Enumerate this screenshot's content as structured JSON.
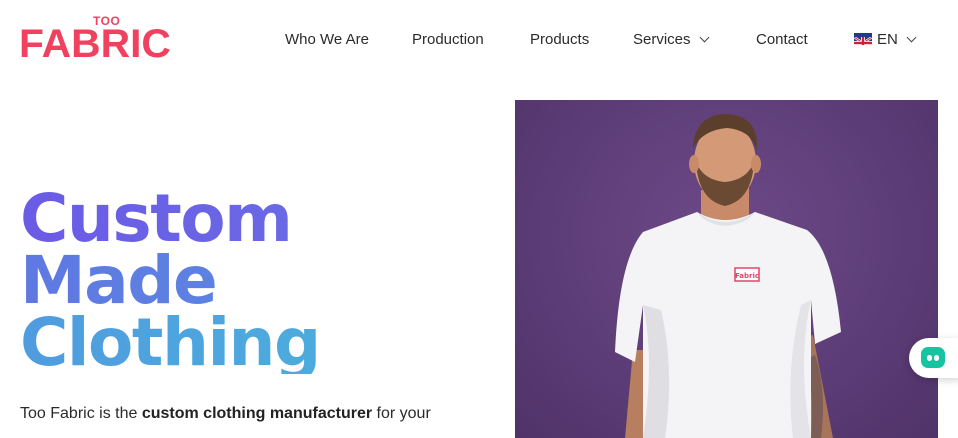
{
  "brand": {
    "logo_small": "TOO",
    "logo_big": "FABRIC",
    "color": "#f0425f"
  },
  "nav": {
    "items": [
      {
        "label": "Who We Are"
      },
      {
        "label": "Production"
      },
      {
        "label": "Products"
      },
      {
        "label": "Services",
        "has_dropdown": true
      },
      {
        "label": "Contact"
      }
    ],
    "language": {
      "label": "EN",
      "icon": "uk-flag-icon",
      "has_dropdown": true
    }
  },
  "hero": {
    "headline": [
      "Custom",
      "Made",
      "Clothing"
    ],
    "intro_prefix": "Too Fabric is the ",
    "intro_bold": "custom clothing manufacturer",
    "intro_suffix": " for your",
    "image": "man-in-white-tshirt-on-purple-background",
    "tshirt_logo": "Fabric",
    "headline_gradient": [
      "#6a5ce6",
      "#4eb4dc"
    ]
  },
  "chat": {
    "icon": "chat-bot-icon",
    "color": "#17c3a0"
  }
}
